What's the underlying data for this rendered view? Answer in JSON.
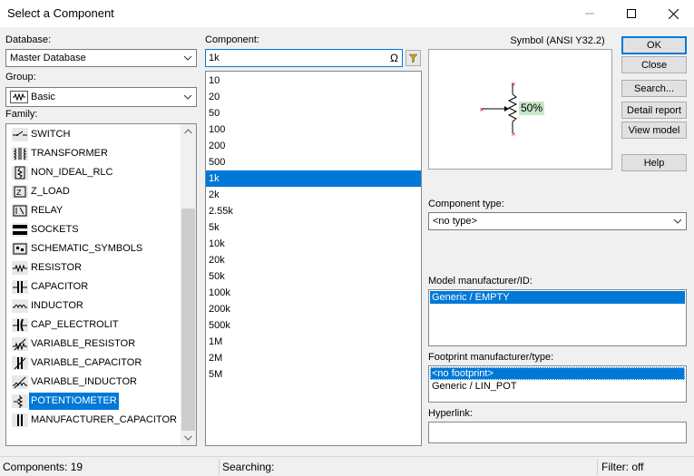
{
  "window": {
    "title": "Select a Component"
  },
  "database": {
    "label": "Database:",
    "value": "Master Database"
  },
  "group": {
    "label": "Group:",
    "value": "Basic"
  },
  "family": {
    "label": "Family:",
    "items": [
      {
        "label": "SWITCH",
        "icon": "switch-icon"
      },
      {
        "label": "TRANSFORMER",
        "icon": "transformer-icon"
      },
      {
        "label": "NON_IDEAL_RLC",
        "icon": "rlc-icon"
      },
      {
        "label": "Z_LOAD",
        "icon": "zload-icon"
      },
      {
        "label": "RELAY",
        "icon": "relay-icon"
      },
      {
        "label": "SOCKETS",
        "icon": "sockets-icon"
      },
      {
        "label": "SCHEMATIC_SYMBOLS",
        "icon": "schematic-icon"
      },
      {
        "label": "RESISTOR",
        "icon": "resistor-icon"
      },
      {
        "label": "CAPACITOR",
        "icon": "capacitor-icon"
      },
      {
        "label": "INDUCTOR",
        "icon": "inductor-icon"
      },
      {
        "label": "CAP_ELECTROLIT",
        "icon": "cap-electrolit-icon"
      },
      {
        "label": "VARIABLE_RESISTOR",
        "icon": "variable-resistor-icon"
      },
      {
        "label": "VARIABLE_CAPACITOR",
        "icon": "variable-capacitor-icon"
      },
      {
        "label": "VARIABLE_INDUCTOR",
        "icon": "variable-inductor-icon"
      },
      {
        "label": "POTENTIOMETER",
        "icon": "potentiometer-icon",
        "selected": true
      },
      {
        "label": "MANUFACTURER_CAPACITOR",
        "icon": "manufacturer-capacitor-icon"
      }
    ]
  },
  "component": {
    "label": "Component:",
    "search_value": "1k",
    "omega": "Ω",
    "items": [
      "10",
      "20",
      "50",
      "100",
      "200",
      "500",
      "1k",
      "2k",
      "2.55k",
      "5k",
      "10k",
      "20k",
      "50k",
      "100k",
      "200k",
      "500k",
      "1M",
      "2M",
      "5M"
    ],
    "selected": "1k"
  },
  "symbol": {
    "label": "Symbol (ANSI Y32.2)",
    "percent": "50%"
  },
  "buttons": {
    "ok": "OK",
    "close": "Close",
    "search": "Search...",
    "detail_report": "Detail report",
    "view_model": "View model",
    "help": "Help"
  },
  "component_type": {
    "label": "Component type:",
    "value": "<no type>"
  },
  "model": {
    "label": "Model manufacturer/ID:",
    "items": [
      "Generic / EMPTY"
    ]
  },
  "footprint": {
    "label": "Footprint manufacturer/type:",
    "items": [
      "<no footprint>",
      "Generic / LIN_POT"
    ]
  },
  "hyperlink": {
    "label": "Hyperlink:",
    "value": ""
  },
  "status": {
    "components": "Components: 19",
    "searching": "Searching:",
    "filter": "Filter: off"
  },
  "colors": {
    "selection": "#0078d7",
    "percent_bg": "#c8e6c8"
  }
}
